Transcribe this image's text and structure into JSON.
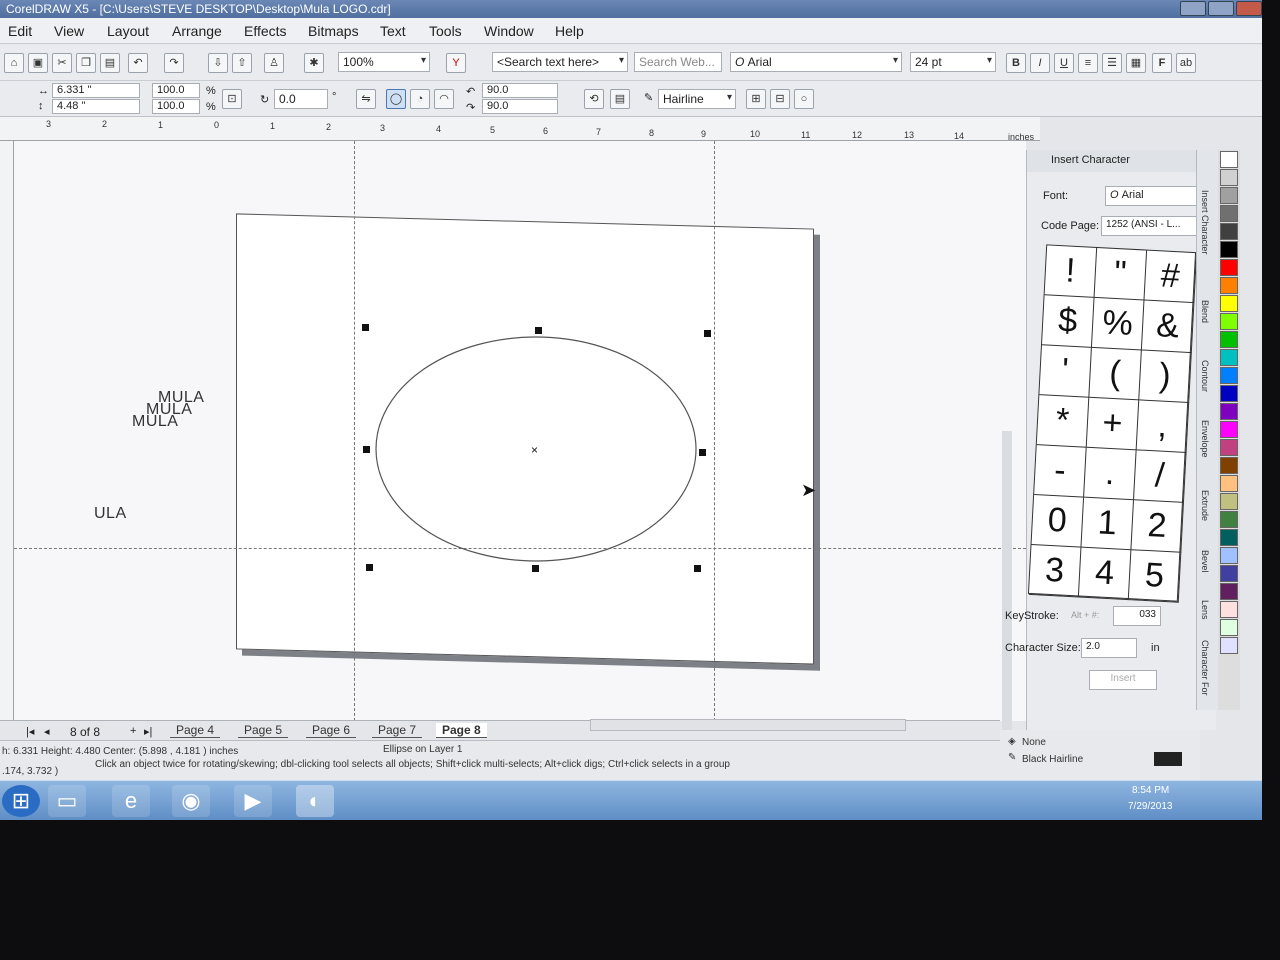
{
  "window": {
    "title": "CorelDRAW X5 - [C:\\Users\\STEVE DESKTOP\\Desktop\\Mula LOGO.cdr]"
  },
  "menu": [
    "Edit",
    "View",
    "Layout",
    "Arrange",
    "Effects",
    "Bitmaps",
    "Text",
    "Tools",
    "Window",
    "Help"
  ],
  "toolbar": {
    "zoom": "100%",
    "search_text": "<Search text here>",
    "search_web": "Search Web...",
    "font": "Arial",
    "font_size": "24 pt"
  },
  "propbar": {
    "width": "6.331 \"",
    "height": "4.48 \"",
    "scale_x": "100.0",
    "scale_y": "100.0",
    "percent": "%",
    "rotation": "0.0",
    "angle_start": "90.0",
    "angle_end": "90.0",
    "outline": "Hairline"
  },
  "ruler": {
    "top_ticks": [
      "3",
      "2",
      "1",
      "0",
      "1",
      "2",
      "3",
      "4",
      "5",
      "6",
      "7",
      "8",
      "9",
      "10",
      "11",
      "12",
      "13",
      "14"
    ],
    "unit": "inches"
  },
  "canvas": {
    "loose_texts": [
      "MULA",
      "MULA",
      "MULA",
      "ULA"
    ]
  },
  "pages": {
    "counter": "8 of 8",
    "tabs": [
      "Page 4",
      "Page 5",
      "Page 6",
      "Page 7",
      "Page 8"
    ],
    "active": "Page 8"
  },
  "status": {
    "dimensions": "h: 6.331  Height: 4.480  Center: (5.898 , 4.181 )  inches",
    "object": "Ellipse on Layer 1",
    "coords": ".174, 3.732 )",
    "hint": "Click an object twice for rotating/skewing; dbl-clicking tool selects all objects; Shift+click multi-selects; Alt+click digs; Ctrl+click selects in a group",
    "fill": "None",
    "outline": "Black  Hairline",
    "clock_time": "8:54 PM",
    "clock_date": "7/29/2013"
  },
  "docker": {
    "title": "Insert Character",
    "font_label": "Font:",
    "font_value": "Arial",
    "codepage_label": "Code Page:",
    "codepage_value": "1252 (ANSI - L...",
    "characters": [
      "!",
      "\"",
      "#",
      "$",
      "%",
      "&",
      "'",
      "(",
      ")",
      "*",
      "+",
      ",",
      "-",
      ".",
      "/",
      "0",
      "1",
      "2",
      "3",
      "4",
      "5"
    ],
    "keystroke_label": "KeyStroke:",
    "keystroke_value": "Alt + #:",
    "keystroke_code": "033",
    "charsize_label": "Character Size:",
    "charsize_value": "2.0",
    "charsize_unit": "in",
    "insert_button": "Insert"
  },
  "side_tabs": [
    "Insert Character",
    "Blend",
    "Contour",
    "Envelope",
    "Extrude",
    "Bevel",
    "Lens",
    "Character For"
  ],
  "palette_colors": [
    "#ffffff",
    "#d0d0d0",
    "#a0a0a0",
    "#707070",
    "#404040",
    "#000000",
    "#ff0000",
    "#ff8000",
    "#ffff00",
    "#80ff00",
    "#00c000",
    "#00c0c0",
    "#0080ff",
    "#0000c0",
    "#8000c0",
    "#ff00ff",
    "#c04080",
    "#804000",
    "#ffc080",
    "#c0c080",
    "#408040",
    "#006060",
    "#a0c0ff",
    "#4040a0",
    "#602060",
    "#ffe0e0",
    "#e0ffe0",
    "#e0e0ff"
  ]
}
